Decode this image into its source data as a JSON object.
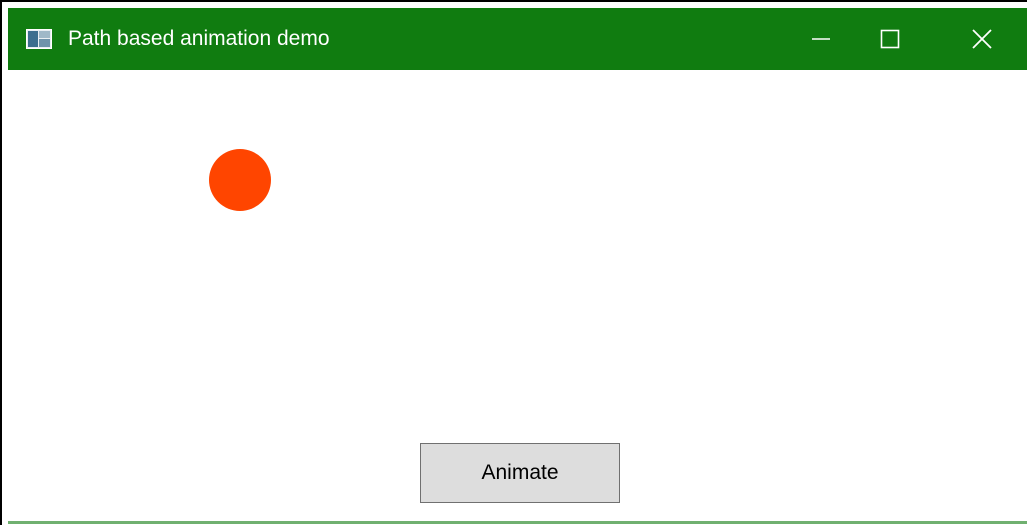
{
  "window": {
    "title": "Path based animation demo",
    "accent_color": "#107c10",
    "title_text_color": "#ffffff",
    "icons": {
      "app": "app-window-icon",
      "minimize": "minimize-icon",
      "maximize": "maximize-icon",
      "close": "close-icon"
    }
  },
  "canvas": {
    "ball_color": "#ff4500"
  },
  "controls": {
    "animate_label": "Animate"
  }
}
